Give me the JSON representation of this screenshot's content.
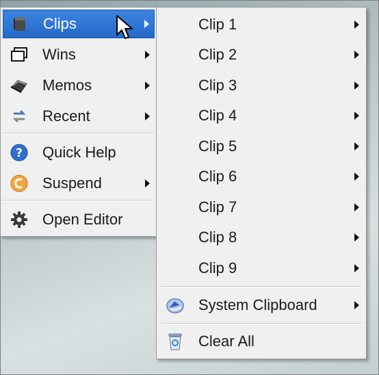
{
  "main_menu": {
    "items": [
      {
        "label": "Clips",
        "icon": "clips-icon",
        "has_submenu": true,
        "highlighted": true
      },
      {
        "label": "Wins",
        "icon": "windows-icon",
        "has_submenu": true
      },
      {
        "label": "Memos",
        "icon": "memos-icon",
        "has_submenu": true
      },
      {
        "label": "Recent",
        "icon": "recent-icon",
        "has_submenu": true
      },
      {
        "label": "Quick Help",
        "icon": "help-icon",
        "has_submenu": false
      },
      {
        "label": "Suspend",
        "icon": "suspend-icon",
        "has_submenu": true
      },
      {
        "label": "Open Editor",
        "icon": "gear-icon",
        "has_submenu": false
      }
    ]
  },
  "clips_submenu": {
    "clips": [
      "Clip 1",
      "Clip 2",
      "Clip 3",
      "Clip 4",
      "Clip 5",
      "Clip 6",
      "Clip 7",
      "Clip 8",
      "Clip 9"
    ],
    "system_clipboard": "System Clipboard",
    "clear_all": "Clear All"
  },
  "colors": {
    "highlight": "#2f76d6",
    "menu_bg": "#f0f0f0"
  }
}
